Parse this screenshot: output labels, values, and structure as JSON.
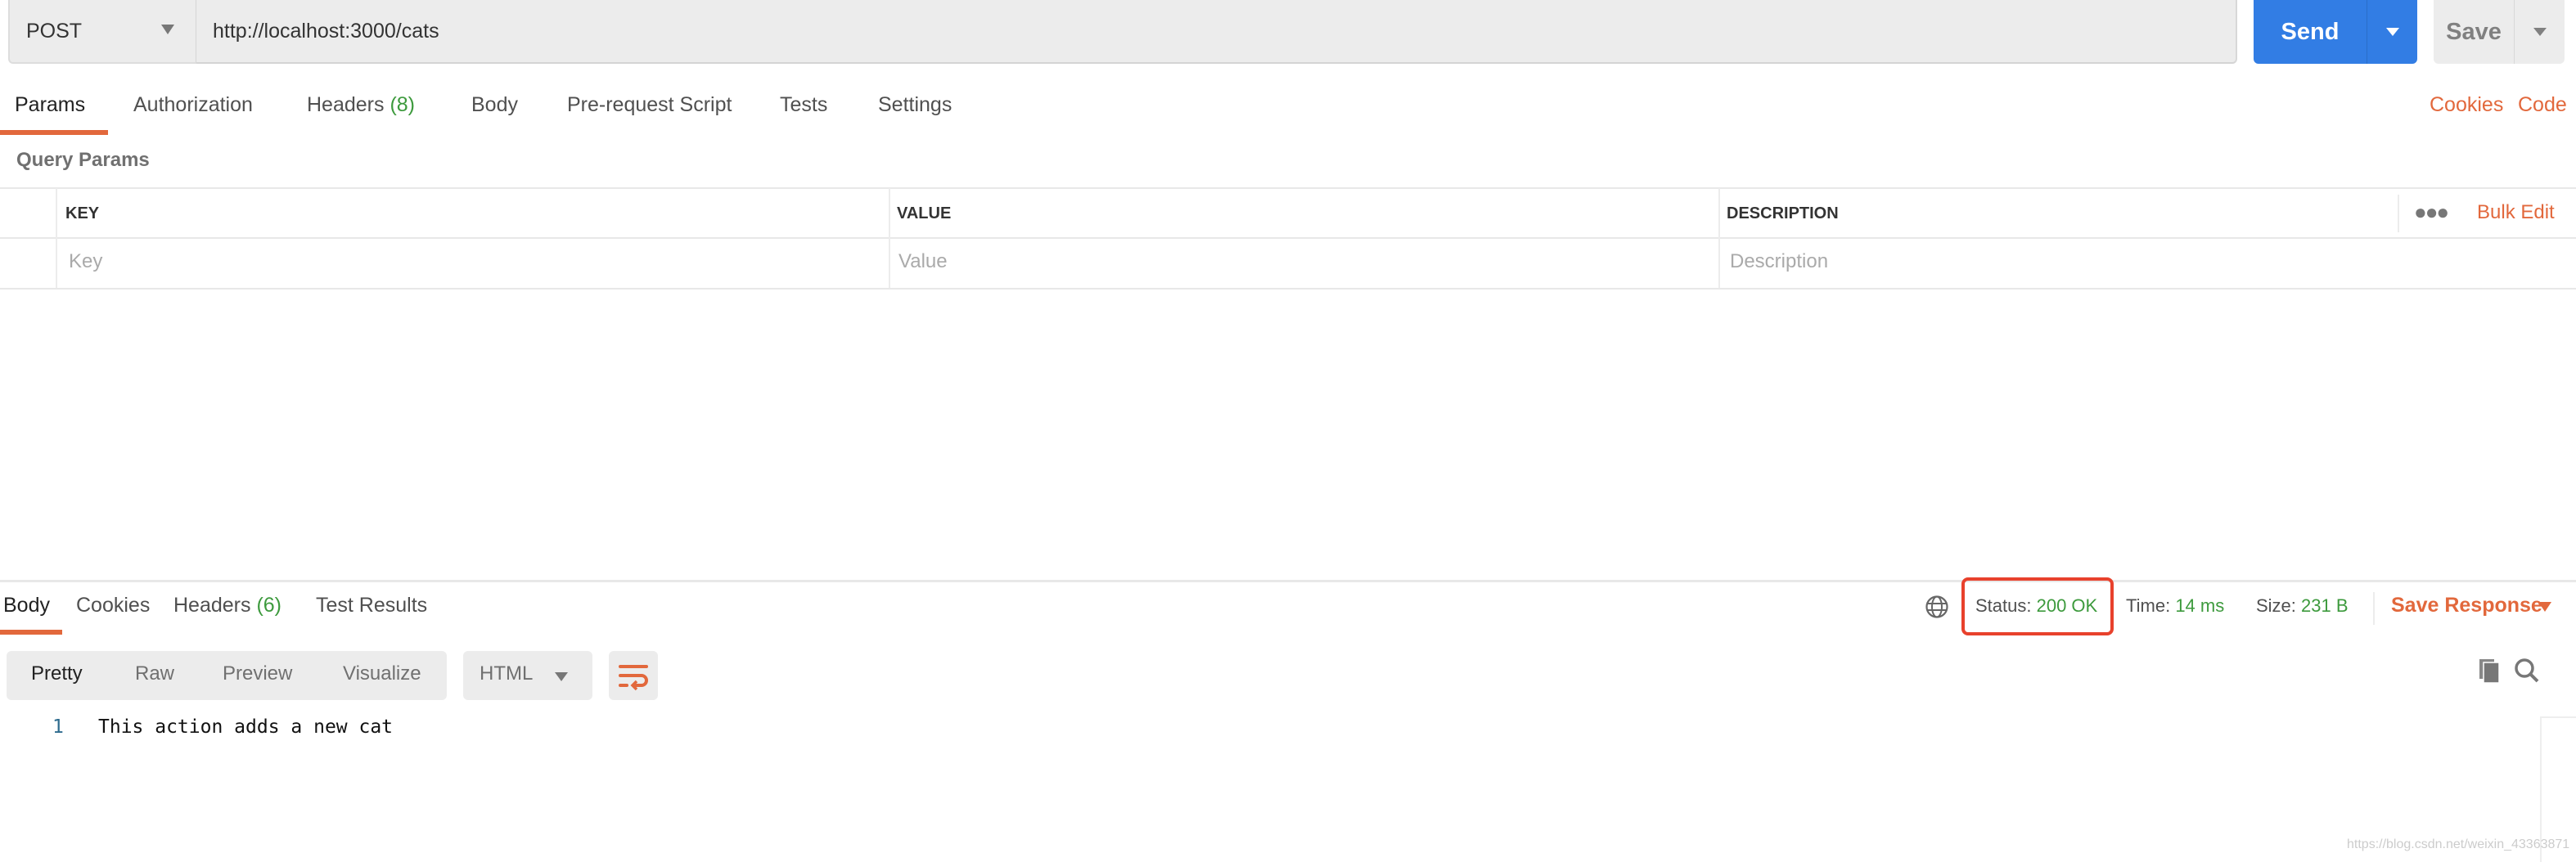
{
  "request": {
    "method": "POST",
    "url": "http://localhost:3000/cats",
    "send_label": "Send",
    "save_label": "Save"
  },
  "request_tabs": [
    {
      "label": "Params",
      "active": true
    },
    {
      "label": "Authorization"
    },
    {
      "label": "Headers",
      "count": "(8)"
    },
    {
      "label": "Body"
    },
    {
      "label": "Pre-request Script"
    },
    {
      "label": "Tests"
    },
    {
      "label": "Settings"
    }
  ],
  "links": {
    "cookies": "Cookies",
    "code": "Code"
  },
  "query_params": {
    "title": "Query Params",
    "columns": [
      "KEY",
      "VALUE",
      "DESCRIPTION"
    ],
    "placeholders": [
      "Key",
      "Value",
      "Description"
    ],
    "bulk_edit": "Bulk Edit"
  },
  "response_tabs": [
    {
      "label": "Body",
      "active": true
    },
    {
      "label": "Cookies"
    },
    {
      "label": "Headers",
      "count": "(6)"
    },
    {
      "label": "Test Results"
    }
  ],
  "response_meta": {
    "status_label": "Status:",
    "status_value": "200 OK",
    "time_label": "Time:",
    "time_value": "14 ms",
    "size_label": "Size:",
    "size_value": "231 B",
    "save_response": "Save Response"
  },
  "view_modes": [
    "Pretty",
    "Raw",
    "Preview",
    "Visualize"
  ],
  "format": "HTML",
  "body_lines": [
    {
      "number": "1",
      "text": "This action adds a new cat"
    }
  ],
  "watermark": "https://blog.csdn.net/weixin_43363871",
  "colors": {
    "accent": "#e2683c",
    "send": "#327de4",
    "success": "#3d9a3d",
    "highlight_box": "#e8412c"
  }
}
